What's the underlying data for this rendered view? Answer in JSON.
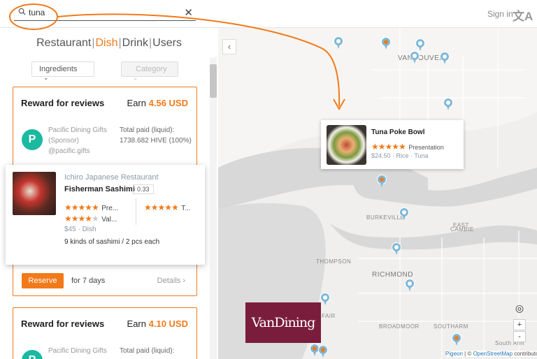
{
  "search": {
    "value": "tuna"
  },
  "header": {
    "signin": "Sign in",
    "translate_icon": "translate-icon"
  },
  "tabs": {
    "restaurant": "Restaurant",
    "dish": "Dish",
    "drink": "Drink",
    "users": "Users",
    "active": "Dish"
  },
  "filters": {
    "ingredients": "Ingredients",
    "category": "Category"
  },
  "cards": [
    {
      "title": "Reward for reviews",
      "earn_label": "Earn",
      "earn_amount": "4.56 USD",
      "sponsor_name": "Pacific Dining Gifts",
      "sponsor_role": "(Sponsor)",
      "sponsor_handle": "@pacific.gifts",
      "paid_label": "Total paid (liquid):",
      "paid_value": "1738.682 HIVE (100%)",
      "reserve": "Reserve",
      "duration": "for 7 days",
      "details": "Details"
    },
    {
      "title": "Reward for reviews",
      "earn_label": "Earn",
      "earn_amount": "4.10 USD",
      "sponsor_name": "Pacific Dining Gifts",
      "paid_label": "Total paid (liquid):"
    }
  ],
  "popup": {
    "restaurant": "Ichiro Japanese Restaurant",
    "dish": "Fisherman Sashimi",
    "score": "0.33",
    "rating1_label": "Pre...",
    "rating2_label": "Val...",
    "rating3_label": "T...",
    "price": "$45 · Dish",
    "description": "9 kinds of sashimi / 2 pcs each",
    "rating1_stars": 5,
    "rating2_stars": 4,
    "rating3_stars": 5
  },
  "map_card": {
    "title": "Tuna Poke Bowl",
    "rating_label": "Presentation",
    "rating_stars": 5,
    "meta": "$24.50 · Rice · Tuna"
  },
  "map": {
    "labels": {
      "vancouver": "VANCOUVER",
      "richmond": "RICHMOND",
      "burkeville": "BURKEVILLE",
      "thompson": "THOMPSON",
      "east": "EAST",
      "cambie": "CAMBIE",
      "broadmoor": "BROADMOOR",
      "southarm": "SOUTHARM",
      "fair": "FAIR",
      "south_arm": "South Arm"
    },
    "attribution": {
      "pigeon": "Pigeon",
      "sep": " | © ",
      "osm": "OpenStreetMap",
      "rest": " contributors"
    },
    "brand": "VanDining",
    "zoom_in": "+",
    "zoom_out": "-"
  },
  "colors": {
    "accent": "#f27a1a",
    "brand_bg": "#7a1d3c",
    "pin_blue": "#7fb8d8"
  }
}
